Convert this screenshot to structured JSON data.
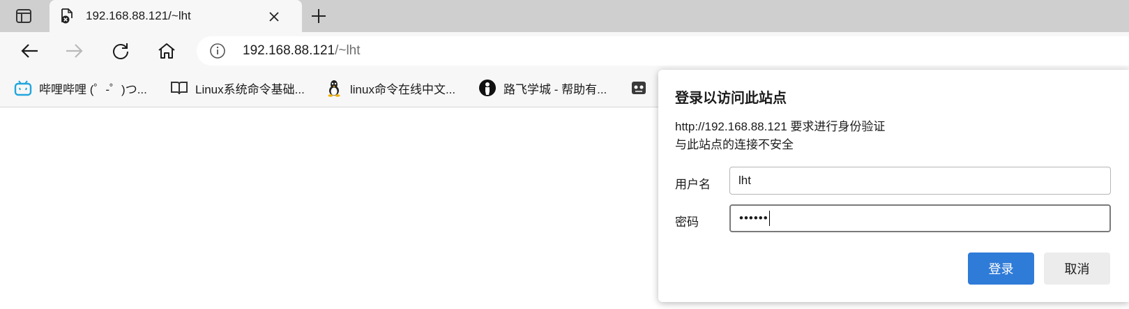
{
  "tab": {
    "title": "192.168.88.121/~lht",
    "favicon": "page-error-icon",
    "close": "close-icon"
  },
  "toolbar": {
    "back": "back-arrow-icon",
    "forward": "forward-arrow-icon",
    "refresh": "refresh-icon",
    "home": "home-icon"
  },
  "address": {
    "host": "192.168.88.121",
    "path": "/~lht",
    "info_icon": "info-icon"
  },
  "bookmarks": [
    {
      "label": "哔哩哔哩 (゜-゜)つ...",
      "icon": "bilibili-icon"
    },
    {
      "label": "Linux系统命令基础...",
      "icon": "book-icon"
    },
    {
      "label": "linux命令在线中文...",
      "icon": "tux-penguin-icon"
    },
    {
      "label": "路飞学城 - 帮助有...",
      "icon": "luffy-icon"
    },
    {
      "label": "",
      "icon": "avatar-icon"
    }
  ],
  "dialog": {
    "title": "登录以访问此站点",
    "line1": "http://192.168.88.121 要求进行身份验证",
    "line2": "与此站点的连接不安全",
    "username_label": "用户名",
    "username_value": "lht",
    "password_label": "密码",
    "password_value": "••••••",
    "login_button": "登录",
    "cancel_button": "取消"
  },
  "colors": {
    "accent": "#2f7bd8",
    "tabstrip": "#cfcfcf",
    "toolbar": "#f7f7f7"
  }
}
